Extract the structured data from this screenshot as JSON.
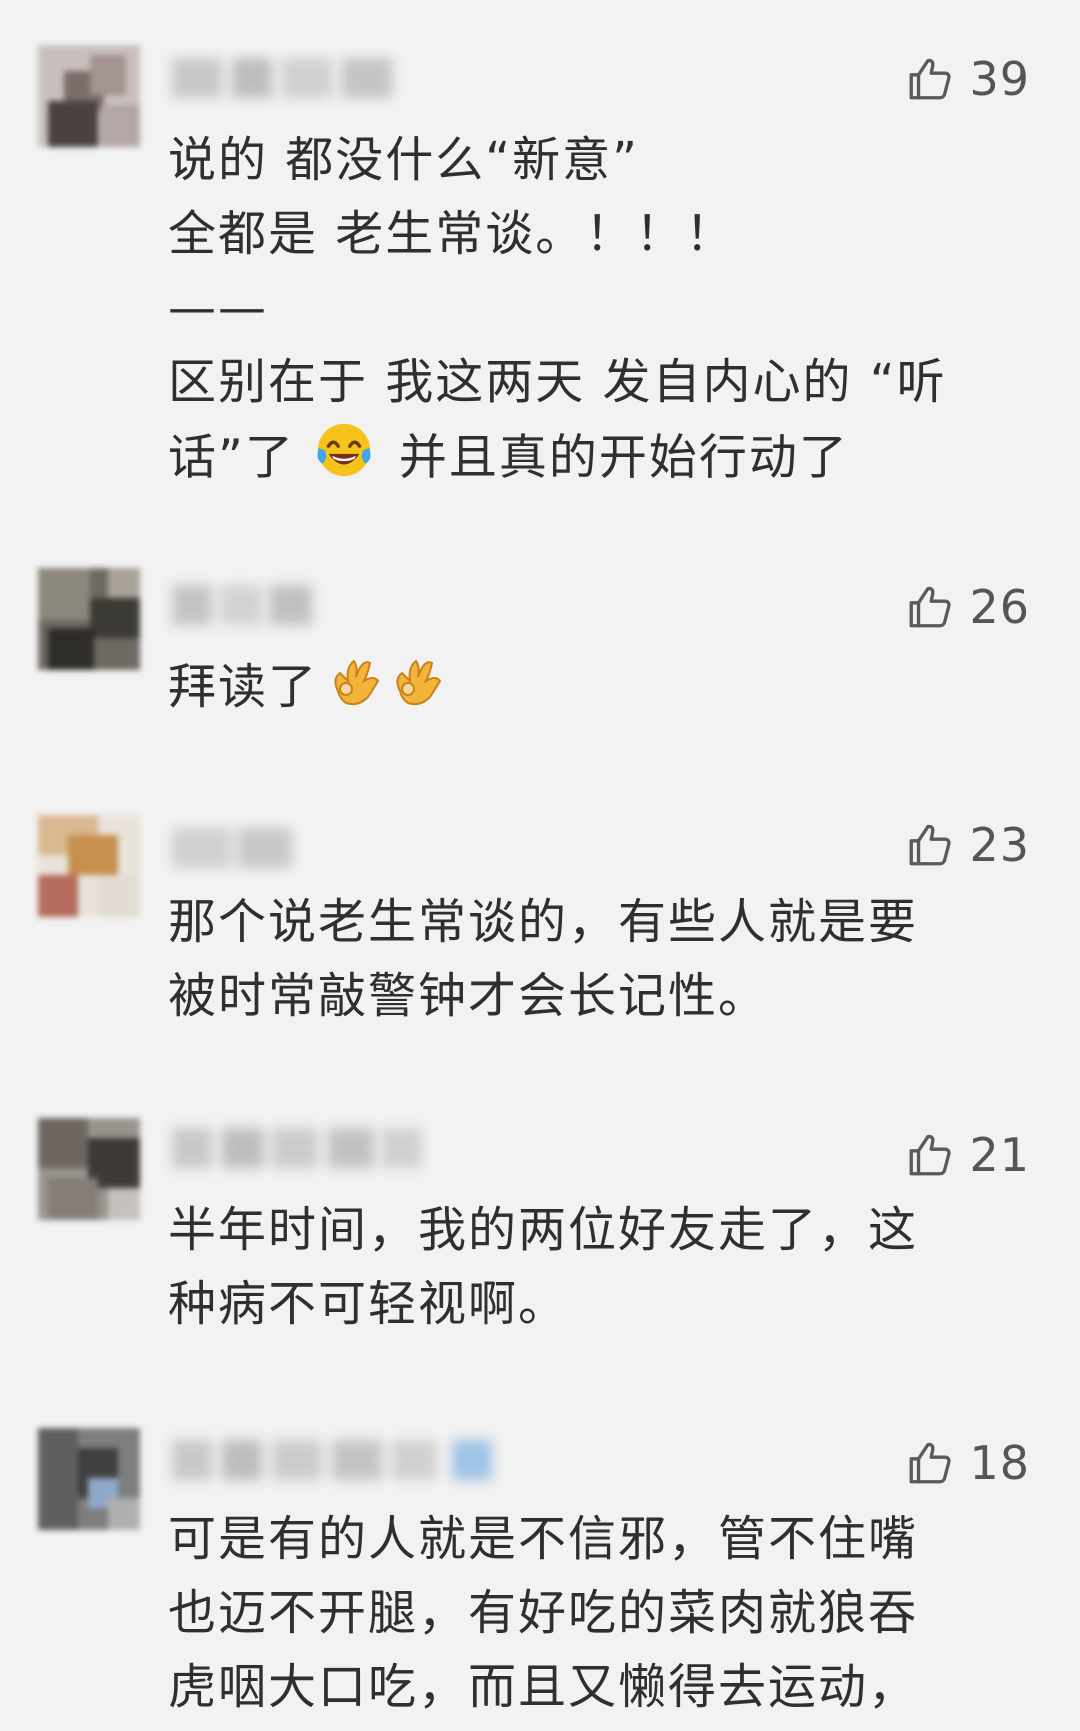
{
  "comments": [
    {
      "likes": "39",
      "lines": [
        "说的 都没什么“新意”",
        "全都是 老生常谈。！！！",
        "——",
        "区别在于  我这两天 发自内心的 “听",
        "话”了",
        "并且真的开始行动了"
      ],
      "emoji": [
        "laughing-tears"
      ]
    },
    {
      "likes": "26",
      "lines": [
        "拜读了"
      ],
      "emoji": [
        "ok-hand",
        "ok-hand"
      ]
    },
    {
      "likes": "23",
      "lines": [
        "那个说老生常谈的，有些人就是要",
        "被时常敲警钟才会长记性。"
      ]
    },
    {
      "likes": "21",
      "lines": [
        "半年时间，我的两位好友走了，这",
        "种病不可轻视啊。"
      ]
    },
    {
      "likes": "18",
      "lines": [
        "可是有的人就是不信邪，管不住嘴",
        "也迈不开腿，有好吃的菜肉就狼吞",
        "虎咽大口吃，而且又懒得去运动，"
      ]
    }
  ],
  "icons": {
    "like": "thumbs-up-icon"
  },
  "colors": {
    "background": "#f2f2f2",
    "text": "#2f2f2f",
    "like": "#5a5a5a"
  }
}
